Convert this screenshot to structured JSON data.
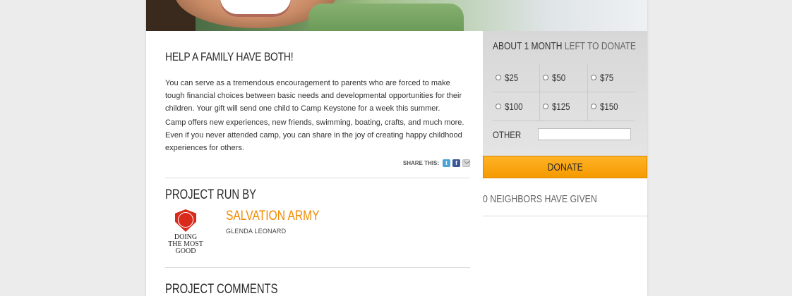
{
  "main": {
    "title": "HELP A FAMILY HAVE BOTH!",
    "paragraphs": [
      "You can serve as a tremendous encouragement to parents who are forced to make tough financial choices between basic needs and developmental opportunities for their children. Your gift will send one child to Camp Keystone for a week this summer.",
      "Camp offers new experiences, new friends, swimming, boating, crafts, and much more. Even if you never attended camp, you can share in the joy of creating happy childhood experiences for others."
    ],
    "share_label": "SHARE THIS:",
    "share_icons": [
      "twitter-icon",
      "facebook-icon",
      "email-icon"
    ],
    "project_run_heading": "PROJECT RUN BY",
    "org": {
      "logo_text_lines": [
        "DOING",
        "THE MOST",
        "GOOD"
      ],
      "name": "SALVATION ARMY",
      "person": "GLENDA LEONARD",
      "name_color": "#f08a00"
    },
    "comments_heading": "PROJECT COMMENTS"
  },
  "sidebar": {
    "time_left_strong": "ABOUT 1 MONTH",
    "time_left_light": "LEFT TO DONATE",
    "amounts": [
      [
        "$25",
        "$50",
        "$75"
      ],
      [
        "$100",
        "$125",
        "$150"
      ]
    ],
    "other_label": "OTHER",
    "other_value": "",
    "donate_label": "DONATE",
    "donate_color": "#f59a00",
    "neighbors": "0 NEIGHBORS HAVE GIVEN"
  }
}
